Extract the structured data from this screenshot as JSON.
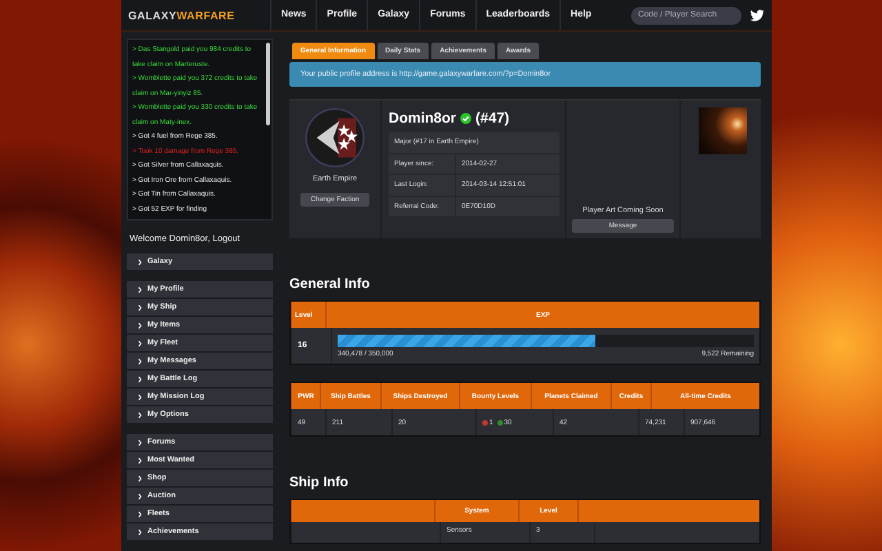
{
  "logo": {
    "part_1": "GALAXY",
    "part_2": "WARFARE"
  },
  "nav": {
    "items": [
      "News",
      "Profile",
      "Galaxy",
      "Forums",
      "Leaderboards",
      "Help"
    ],
    "search": {
      "placeholder": "Code / Player Search"
    }
  },
  "log": [
    {
      "kind": "credit",
      "text": "> Das Stangold paid you 984 credits to take claim on Marteruste."
    },
    {
      "kind": "credit",
      "text": "> Womblette paid you 372 credits to take claim on Mar-yinyiz 85."
    },
    {
      "kind": "credit",
      "text": "> Womblette paid you 330 credits to take claim on Maty-inex."
    },
    {
      "kind": "info",
      "text": "> Got 4 fuel from Rege 385."
    },
    {
      "kind": "damage",
      "text": "> Took 10 damage from Rege 385."
    },
    {
      "kind": "info",
      "text": "> Got Silver from Callaxaquis."
    },
    {
      "kind": "info",
      "text": "> Got Iron Ore from Callaxaquis."
    },
    {
      "kind": "info",
      "text": "> Got Tin from Callaxaquis."
    },
    {
      "kind": "info",
      "text": "> Got 52 EXP for finding"
    }
  ],
  "welcome": {
    "text": "Welcome Domin8or,",
    "link": "Logout"
  },
  "menu_groups": [
    [
      "Galaxy"
    ],
    [
      "My Profile",
      "My Ship",
      "My Items",
      "My Fleet",
      "My Messages",
      "My Battle Log",
      "My Mission Log",
      "My Options"
    ],
    [
      "Forums",
      "Most Wanted",
      "Shop",
      "Auction",
      "Fleets",
      "Achievements"
    ]
  ],
  "tabs": [
    {
      "label": "General Information",
      "selected": true
    },
    {
      "label": "Daily Stats",
      "selected": false
    },
    {
      "label": "Achievements",
      "selected": false
    },
    {
      "label": "Awards",
      "selected": false
    }
  ],
  "notice": "Your public profile address is http://game.galaxywarfare.com/?p=Domin8or",
  "profile": {
    "faction": "Earth Empire",
    "change_faction": "Change Faction",
    "name": "Domin8or",
    "verified": true,
    "rank_no": "(#47)",
    "rank": "Major (#17 in Earth Empire)",
    "fields": [
      {
        "label": "Player since:",
        "value": "2014-02-27"
      },
      {
        "label": "Last Login:",
        "value": "2014-03-14 12:51:01"
      },
      {
        "label": "Referral Code:",
        "value": "0E70D10D"
      }
    ],
    "art_note": "Player Art Coming Soon",
    "message": "Message"
  },
  "general_info": {
    "title": "General Info",
    "level_header": "Level",
    "exp_header": "EXP",
    "level": "16",
    "exp": {
      "level": 0.62,
      "progress": "340,478 / 350,000",
      "remaining": "9,522 Remaining"
    },
    "stats_columns": [
      "PWR",
      "Ship Battles",
      "Ships Destroyed",
      "Bounty Levels",
      "Planets Claimed",
      "Credits",
      "All-time Credits"
    ],
    "stats_row": {
      "pwr": "49",
      "ship_battles": "211",
      "ships_destroyed": "20",
      "bounty": [
        {
          "color": "#c0392b",
          "value": "1"
        },
        {
          "color": "#2e8b2e",
          "value": "30"
        }
      ],
      "planets_claimed": "42",
      "credits": "74,231",
      "alltime_credits": "907,646"
    }
  },
  "ship_info": {
    "title": "Ship Info",
    "columns": [
      "System",
      "Level"
    ],
    "rows": [
      {
        "system": "Sensors",
        "level": "3"
      }
    ]
  }
}
